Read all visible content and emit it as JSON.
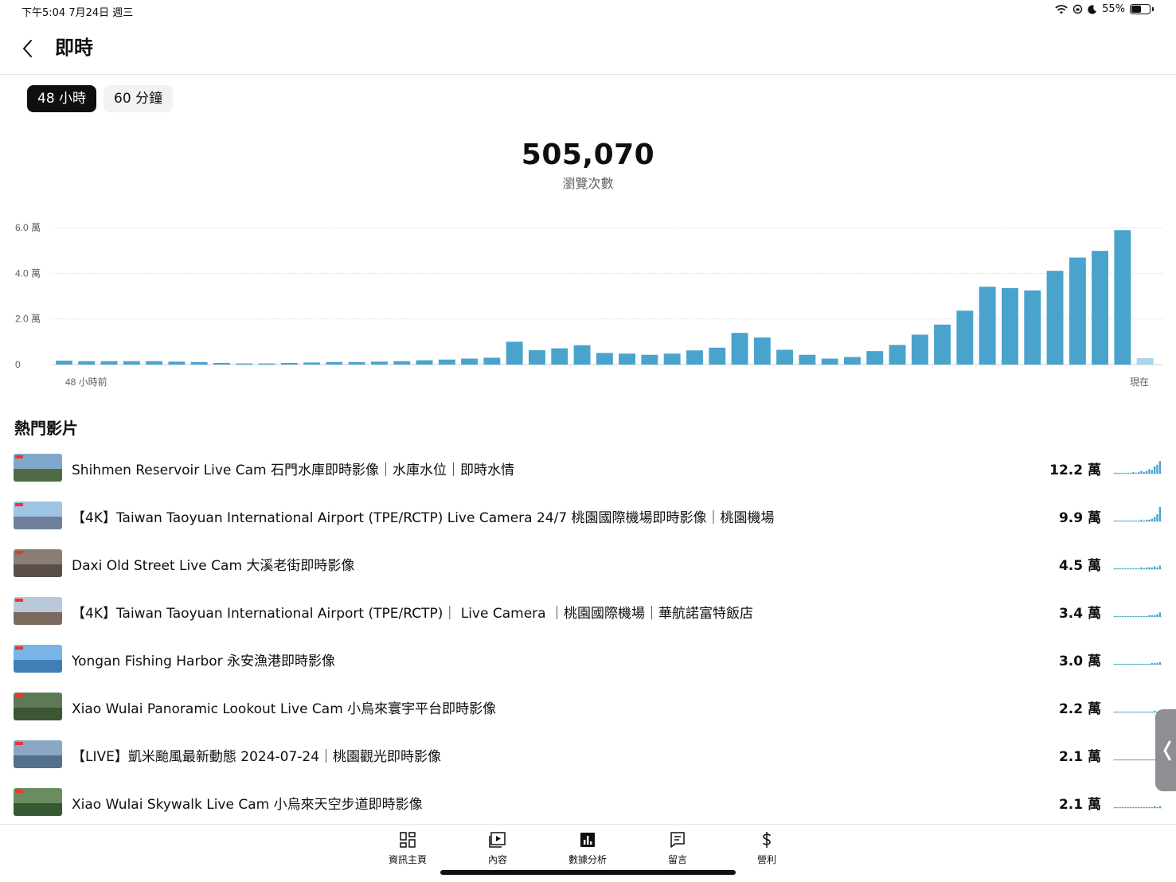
{
  "status_bar": {
    "time_date": "下午5:04   7月24日 週三",
    "battery_text": "55%",
    "battery_level": 0.55
  },
  "header": {
    "title": "即時"
  },
  "chips": [
    {
      "label": "48 小時",
      "active": true
    },
    {
      "label": "60 分鐘",
      "active": false
    }
  ],
  "summary": {
    "total_value": "505,070",
    "total_label": "瀏覽次數"
  },
  "chart_data": {
    "type": "bar",
    "color": "#4aa3cc",
    "last_bar_color": "#a8d5ea",
    "ylim": [
      0,
      60000
    ],
    "y_ticks": [
      {
        "value": 0,
        "label": "0"
      },
      {
        "value": 20000,
        "label": "2.0 萬"
      },
      {
        "value": 40000,
        "label": "4.0 萬"
      },
      {
        "value": 60000,
        "label": "6.0 萬"
      }
    ],
    "x_start_label": "48 小時前",
    "x_end_label": "現在",
    "values": [
      1700,
      1500,
      1500,
      1500,
      1500,
      1300,
      1100,
      700,
      500,
      500,
      700,
      900,
      1100,
      1100,
      1300,
      1500,
      1900,
      2200,
      2600,
      3000,
      10000,
      6300,
      7100,
      8500,
      5100,
      4800,
      4300,
      4800,
      6200,
      7400,
      13900,
      11900,
      6500,
      4300,
      2600,
      3300,
      5900,
      8600,
      13100,
      17500,
      23600,
      34100,
      33500,
      32500,
      41100,
      46900,
      49800,
      58900,
      2800
    ]
  },
  "section": {
    "title": "熱門影片"
  },
  "videos": [
    {
      "title": "Shihmen Reservoir Live Cam 石門水庫即時影像｜水庫水位｜即時水情",
      "views": "12.2 萬",
      "thumb_sky": "#7fa7c9",
      "thumb_ground": "#4f6b45",
      "spark": [
        1,
        1,
        1,
        1,
        1,
        1,
        1,
        2,
        1,
        2,
        3,
        2,
        3,
        5,
        4,
        8,
        10,
        14
      ]
    },
    {
      "title": "【4K】Taiwan Taoyuan International Airport (TPE/RCTP) Live Camera 24/7 桃園國際機場即時影像｜桃園機場",
      "views": "9.9 萬",
      "thumb_sky": "#9fc3e2",
      "thumb_ground": "#6d7f99",
      "spark": [
        1,
        1,
        1,
        1,
        1,
        1,
        1,
        1,
        1,
        1,
        2,
        1,
        2,
        2,
        3,
        5,
        8,
        16
      ]
    },
    {
      "title": "Daxi Old Street Live Cam 大溪老街即時影像",
      "views": "4.5 萬",
      "thumb_sky": "#8b7d73",
      "thumb_ground": "#5a4f48",
      "spark": [
        1,
        1,
        1,
        1,
        1,
        1,
        1,
        1,
        1,
        1,
        2,
        1,
        2,
        2,
        2,
        3,
        2,
        4
      ]
    },
    {
      "title": "【4K】Taiwan Taoyuan International Airport (TPE/RCTP)｜ Live Camera ｜桃園國際機場｜華航諾富特飯店",
      "views": "3.4 萬",
      "thumb_sky": "#b7c9d9",
      "thumb_ground": "#7a6a5d",
      "spark": [
        1,
        1,
        1,
        1,
        1,
        1,
        1,
        1,
        1,
        1,
        1,
        1,
        1,
        2,
        2,
        2,
        3,
        5
      ]
    },
    {
      "title": "Yongan Fishing Harbor 永安漁港即時影像",
      "views": "3.0 萬",
      "thumb_sky": "#7ab3e6",
      "thumb_ground": "#3f7fb5",
      "spark": [
        1,
        1,
        1,
        1,
        1,
        1,
        1,
        1,
        1,
        1,
        1,
        1,
        1,
        1,
        2,
        2,
        2,
        3
      ]
    },
    {
      "title": "Xiao Wulai Panoramic Lookout Live Cam 小烏來寰宇平台即時影像",
      "views": "2.2 萬",
      "thumb_sky": "#5d7a55",
      "thumb_ground": "#3c5535",
      "spark": [
        1,
        1,
        1,
        1,
        1,
        1,
        1,
        1,
        1,
        1,
        1,
        1,
        1,
        1,
        1,
        2,
        1,
        2
      ]
    },
    {
      "title": "【LIVE】凱米颱風最新動態 2024-07-24｜桃園觀光即時影像",
      "views": "2.1 萬",
      "thumb_sky": "#8aa8c4",
      "thumb_ground": "#52708c",
      "spark": [
        1,
        1,
        1,
        1,
        1,
        1,
        1,
        1,
        1,
        1,
        1,
        1,
        1,
        1,
        1,
        1,
        1,
        1
      ]
    },
    {
      "title": "Xiao Wulai Skywalk Live Cam 小烏來天空步道即時影像",
      "views": "2.1 萬",
      "thumb_sky": "#6b8c5e",
      "thumb_ground": "#355a33",
      "spark": [
        1,
        1,
        1,
        1,
        1,
        1,
        1,
        1,
        1,
        1,
        1,
        1,
        1,
        1,
        1,
        2,
        1,
        2
      ]
    }
  ],
  "tabs": [
    {
      "label": "資訊主頁",
      "icon": "dashboard-icon"
    },
    {
      "label": "內容",
      "icon": "content-icon"
    },
    {
      "label": "數據分析",
      "icon": "analytics-icon"
    },
    {
      "label": "留言",
      "icon": "comments-icon"
    },
    {
      "label": "營利",
      "icon": "earn-icon"
    }
  ]
}
